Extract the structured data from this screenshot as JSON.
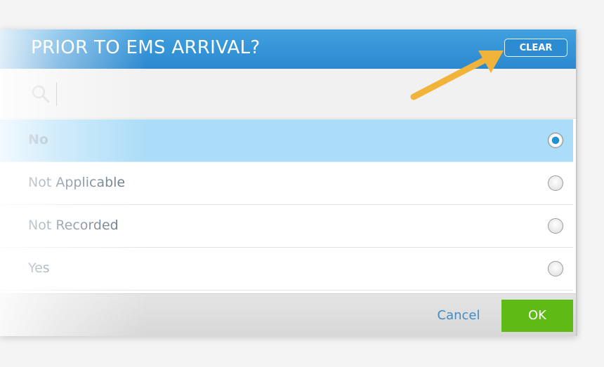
{
  "dialog": {
    "title": "PRIOR TO EMS ARRIVAL?",
    "clear_label": "CLEAR"
  },
  "search": {
    "placeholder": "",
    "value": "",
    "icon": "search-icon"
  },
  "options": [
    {
      "label": "No",
      "selected": true
    },
    {
      "label": "Not Applicable",
      "selected": false
    },
    {
      "label": "Not Recorded",
      "selected": false
    },
    {
      "label": "Yes",
      "selected": false
    }
  ],
  "footer": {
    "cancel_label": "Cancel",
    "ok_label": "OK"
  },
  "colors": {
    "header": "#2b88cf",
    "selected_row": "#abdcf8",
    "ok_button": "#5dbb14",
    "annotation_arrow": "#f2b33a"
  }
}
